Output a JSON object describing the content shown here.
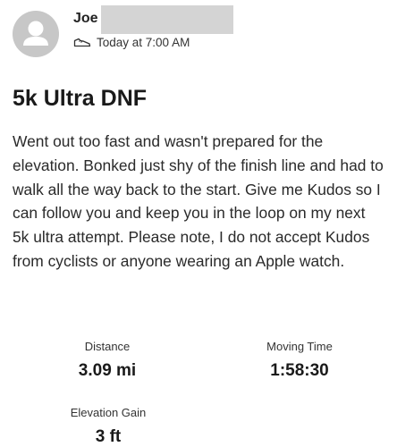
{
  "author": {
    "name": "Joe"
  },
  "activity": {
    "type_icon": "shoe-icon",
    "timestamp": "Today at 7:00 AM",
    "title": "5k Ultra DNF",
    "description": "Went out too fast and wasn't prepared for the elevation.  Bonked just shy of the finish line and had to walk all the way back to the start.  Give me Kudos so I can follow you and keep you in the loop on my next 5k ultra attempt.  Please note, I do not accept Kudos from cyclists or anyone wearing an Apple watch."
  },
  "stats": {
    "distance": {
      "label": "Distance",
      "value": "3.09 mi"
    },
    "moving_time": {
      "label": "Moving Time",
      "value": "1:58:30"
    },
    "elevation_gain": {
      "label": "Elevation Gain",
      "value": "3 ft"
    }
  }
}
